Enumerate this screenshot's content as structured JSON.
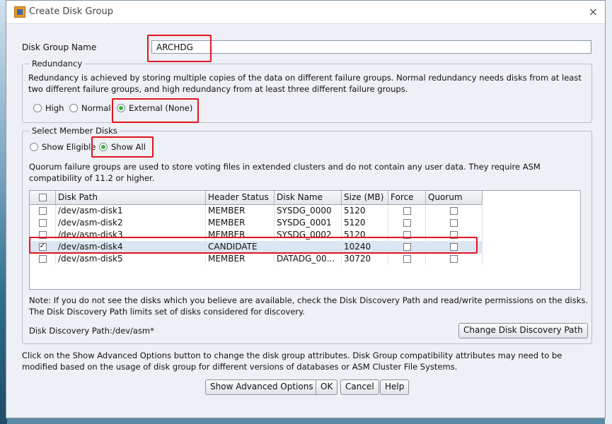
{
  "window": {
    "title": "Create Disk Group",
    "close_glyph": "×"
  },
  "diskgroup": {
    "label": "Disk Group Name",
    "value": "ARCHDG"
  },
  "redundancy": {
    "title": "Redundancy",
    "description": "Redundancy is achieved by storing multiple copies of the data on different failure groups. Normal redundancy needs disks from at least two different failure groups, and high redundancy from at least three different failure groups.",
    "options": [
      "High",
      "Normal",
      "External (None)"
    ],
    "selected": "External (None)"
  },
  "member_disks": {
    "title": "Select Member Disks",
    "options": [
      "Show Eligible",
      "Show All"
    ],
    "selected": "Show All",
    "quorum_note": "Quorum failure groups are used to store voting files in extended clusters and do not contain any user data. They require ASM compatibility of 11.2 or higher."
  },
  "table": {
    "columns": [
      "",
      "Disk Path",
      "Header Status",
      "Disk Name",
      "Size (MB)",
      "Force",
      "Quorum"
    ],
    "rows": [
      {
        "path": "/dev/asm-disk1",
        "status": "MEMBER",
        "name": "SYSDG_0000",
        "size": "5120",
        "checked": false
      },
      {
        "path": "/dev/asm-disk2",
        "status": "MEMBER",
        "name": "SYSDG_0001",
        "size": "5120",
        "checked": false
      },
      {
        "path": "/dev/asm-disk3",
        "status": "MEMBER",
        "name": "SYSDG_0002",
        "size": "5120",
        "checked": false
      },
      {
        "path": "/dev/asm-disk4",
        "status": "CANDIDATE",
        "name": "",
        "size": "10240",
        "checked": true
      },
      {
        "path": "/dev/asm-disk5",
        "status": "MEMBER",
        "name": "DATADG_00...",
        "size": "30720",
        "checked": false
      }
    ]
  },
  "note": "Note: If you do not see the disks which you believe are available, check the Disk Discovery Path and read/write permissions on the disks. The Disk Discovery Path limits set of disks considered for discovery.",
  "discovery": {
    "label": "Disk Discovery Path:/dev/asm*",
    "button": "Change Disk Discovery Path"
  },
  "advanced_note": "Click on the Show Advanced Options button to change the disk group attributes. Disk Group compatibility attributes may need to be modified based on the usage of disk group for different versions of databases or ASM Cluster File Systems.",
  "buttons": {
    "advanced": "Show Advanced Options",
    "ok": "OK",
    "cancel": "Cancel",
    "help": "Help"
  },
  "colors": {
    "highlight": "#e0141e",
    "radio_on": "#3cae45"
  }
}
